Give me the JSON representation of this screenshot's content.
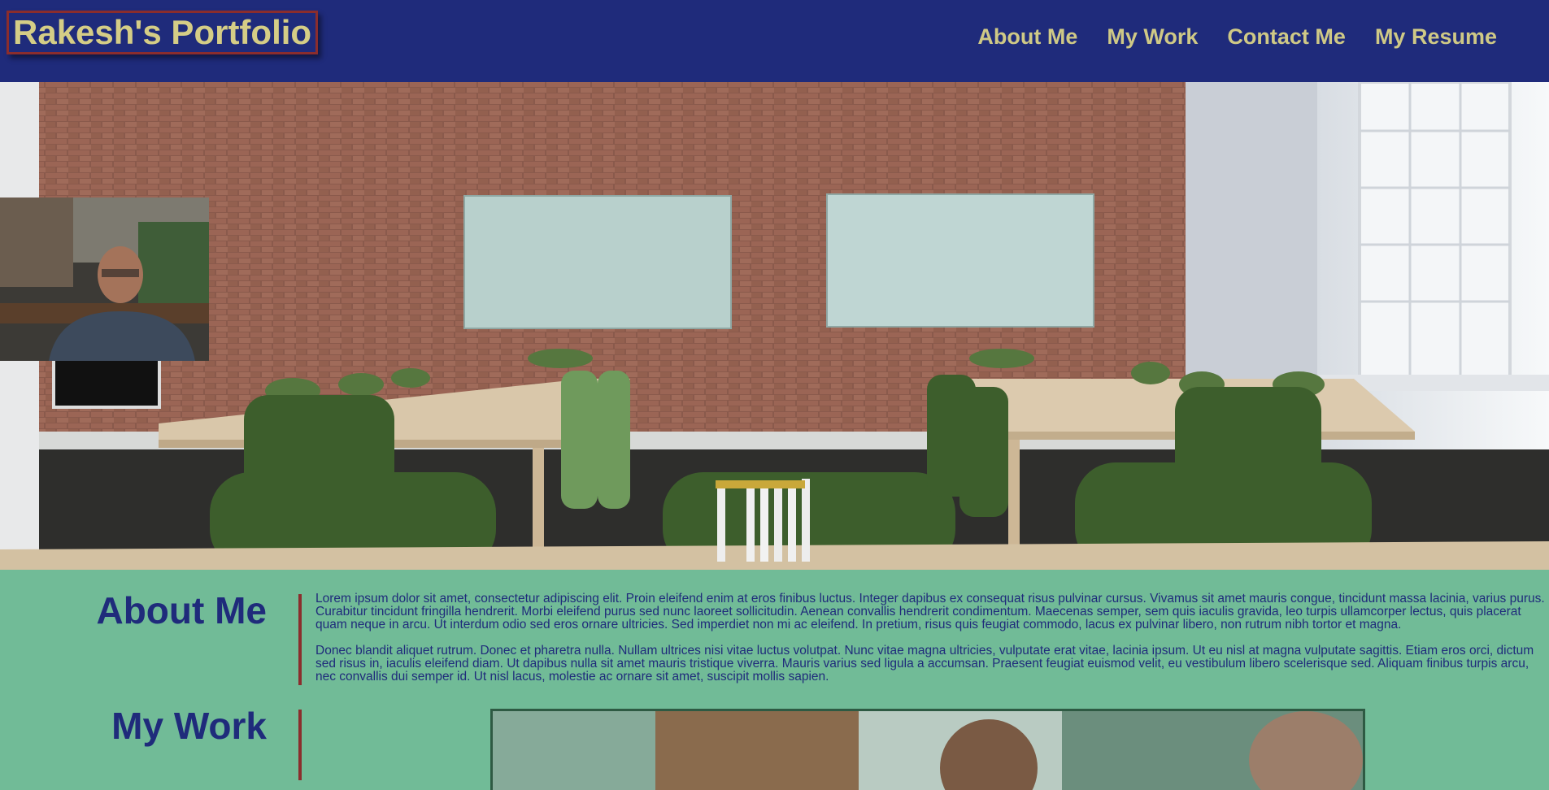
{
  "header": {
    "logo": "Rakesh's Portfolio",
    "nav": [
      {
        "label": "About Me"
      },
      {
        "label": "My Work"
      },
      {
        "label": "Contact Me"
      },
      {
        "label": "My Resume"
      }
    ]
  },
  "about": {
    "title": "About Me",
    "paragraphs": [
      "Lorem ipsum dolor sit amet, consectetur adipiscing elit. Proin eleifend enim at eros finibus luctus. Integer dapibus ex consequat risus pulvinar cursus. Vivamus sit amet mauris congue, tincidunt massa lacinia, varius purus. Curabitur tincidunt fringilla hendrerit. Morbi eleifend purus sed nunc laoreet sollicitudin. Aenean convallis hendrerit condimentum. Maecenas semper, sem quis iaculis gravida, leo turpis ullamcorper lectus, quis placerat quam neque in arcu. Ut interdum odio sed eros ornare ultricies. Sed imperdiet non mi ac eleifend. In pretium, risus quis feugiat commodo, lacus ex pulvinar libero, non rutrum nibh tortor et magna.",
      "Donec blandit aliquet rutrum. Donec et pharetra nulla. Nullam ultrices nisi vitae luctus volutpat. Nunc vitae magna ultricies, vulputate erat vitae, lacinia ipsum. Ut eu nisl at magna vulputate sagittis. Etiam eros orci, dictum sed risus in, iaculis eleifend diam. Ut dapibus nulla sit amet mauris tristique viverra. Mauris varius sed ligula a accumsan. Praesent feugiat euismod velit, eu vestibulum libero scelerisque sed. Aliquam finibus turpis arcu, nec convallis dui semper id. Ut nisl lacus, molestie ac ornare sit amet, suscipit mollis sapien."
    ]
  },
  "work": {
    "title": "My Work"
  },
  "colors": {
    "header_bg": "#1f2b7b",
    "accent_gold": "#d5cd86",
    "accent_red": "#8b2d2d",
    "page_bg": "#71bb97"
  }
}
